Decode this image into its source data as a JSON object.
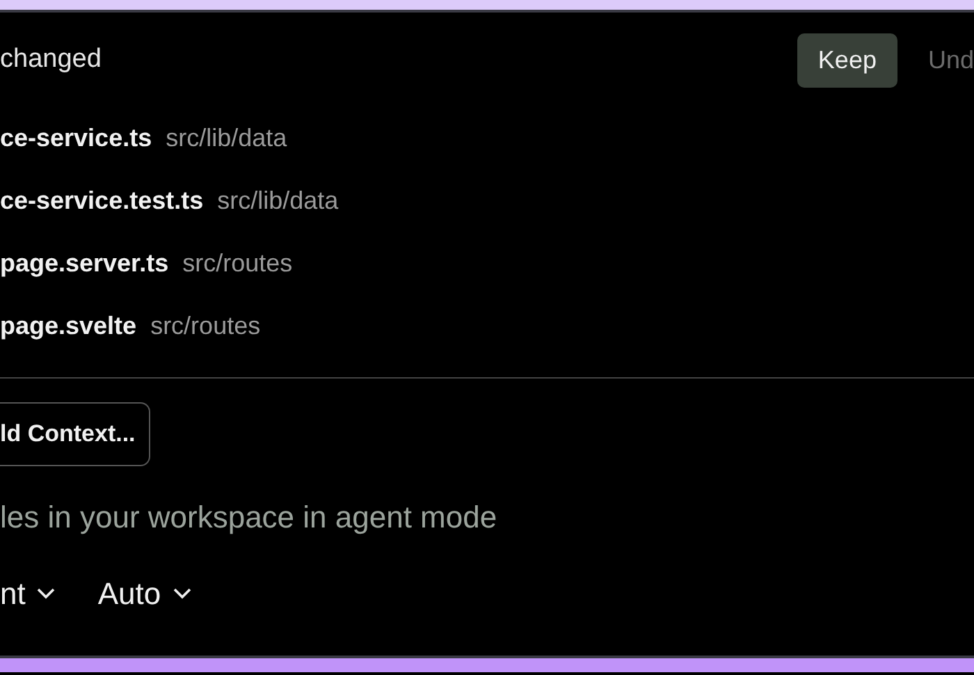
{
  "header": {
    "title": "changed",
    "buttons": [
      {
        "label": "Keep",
        "kind": "primary"
      },
      {
        "label": "Und",
        "kind": "plain"
      }
    ]
  },
  "files": [
    {
      "name": "ce-service.ts",
      "path": "src/lib/data"
    },
    {
      "name": "ce-service.test.ts",
      "path": "src/lib/data"
    },
    {
      "name": "page.server.ts",
      "path": "src/routes"
    },
    {
      "name": "page.svelte",
      "path": "src/routes"
    }
  ],
  "context_button": {
    "label": "ld Context..."
  },
  "input": {
    "placeholder": "les in your workspace in agent mode"
  },
  "dropdowns": [
    {
      "label": "nt"
    },
    {
      "label": "Auto"
    }
  ]
}
